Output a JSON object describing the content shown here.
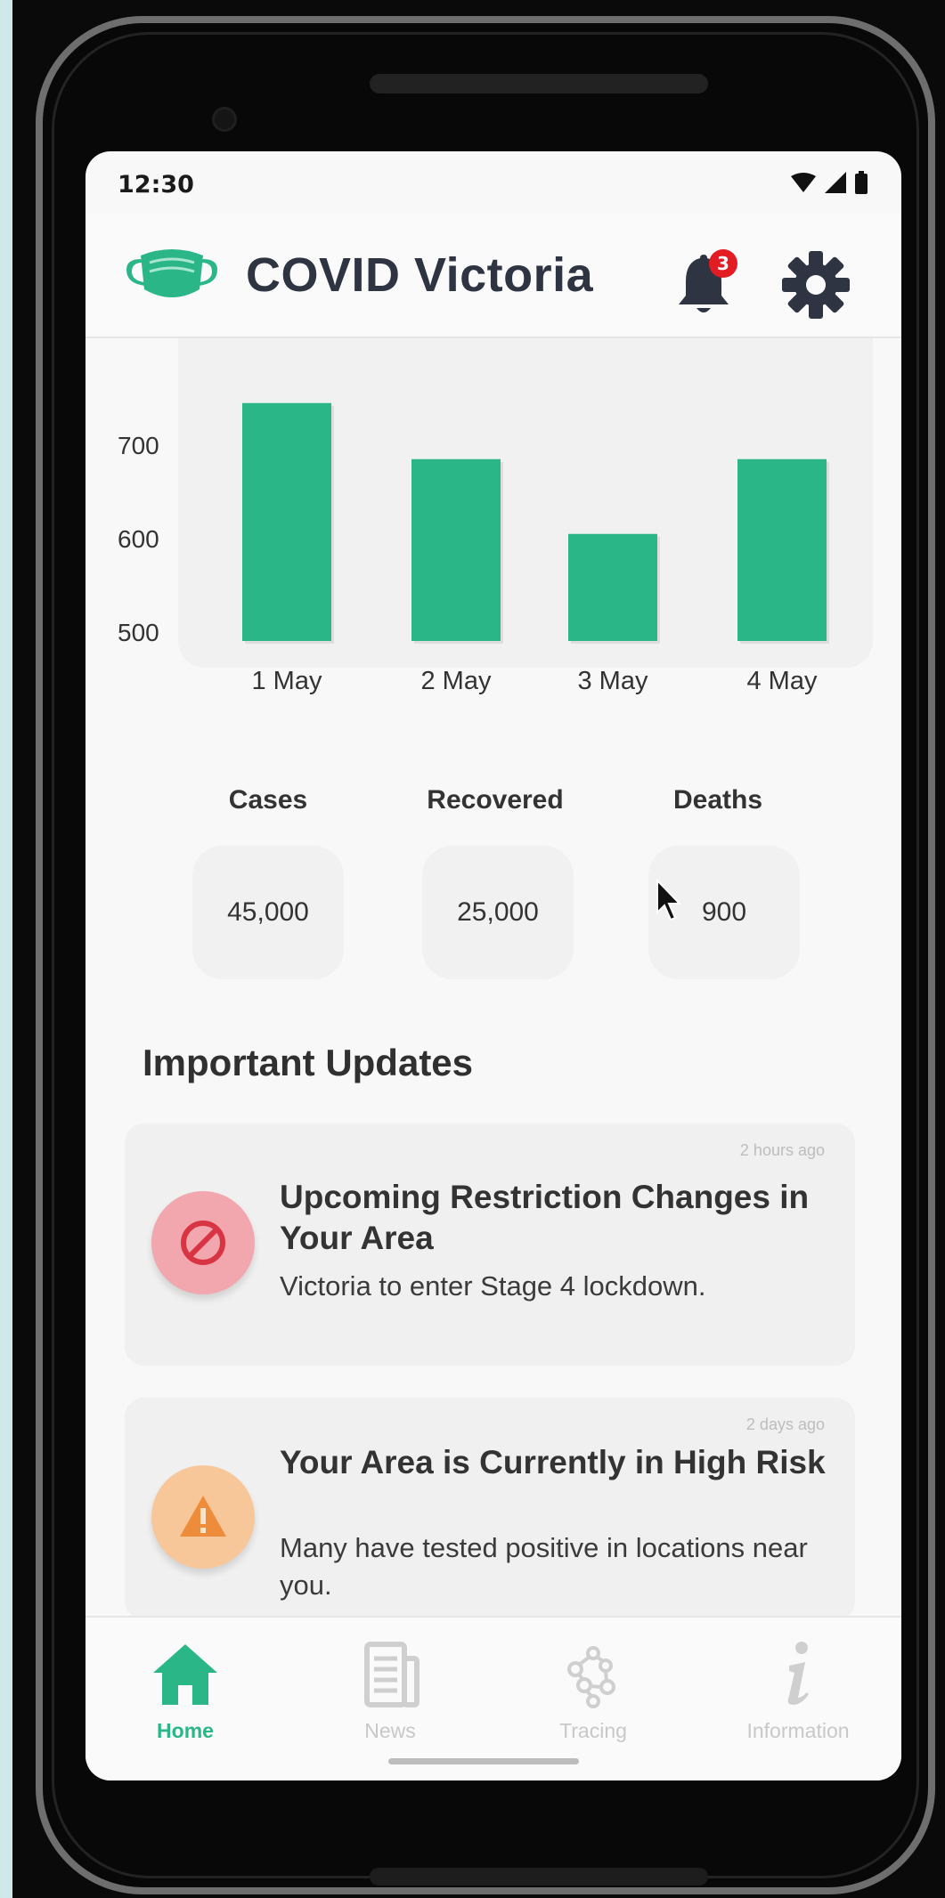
{
  "status_bar": {
    "time": "12:30"
  },
  "header": {
    "title": "COVID Victoria",
    "notification_count": "3",
    "accent_color": "#2bb688"
  },
  "chart_data": {
    "type": "bar",
    "categories": [
      "1 May",
      "2 May",
      "3 May",
      "4 May"
    ],
    "values": [
      745,
      685,
      605,
      685
    ],
    "yticks": [
      "700",
      "600",
      "500"
    ],
    "ylim": [
      500,
      750
    ],
    "grid": false,
    "bar_color": "#2bb688"
  },
  "stats": {
    "cases_label": "Cases",
    "cases_value": "45,000",
    "recovered_label": "Recovered",
    "recovered_value": "25,000",
    "deaths_label": "Deaths",
    "deaths_value": "900"
  },
  "updates": {
    "section_title": "Important Updates",
    "items": [
      {
        "time": "2 hours ago",
        "title": "Upcoming Restriction Changes in Your Area",
        "body": "Victoria to enter Stage 4 lockdown.",
        "icon": "no-entry-icon",
        "color": "#f1a7ad"
      },
      {
        "time": "2 days ago",
        "title": "Your Area is Currently in High Risk",
        "body": "Many have tested positive in locations near you.",
        "icon": "warning-icon",
        "color": "#f7c79a"
      }
    ]
  },
  "bottom_nav": {
    "items": [
      {
        "label": "Home",
        "icon": "home-icon",
        "active": true
      },
      {
        "label": "News",
        "icon": "news-icon",
        "active": false
      },
      {
        "label": "Tracing",
        "icon": "tracing-icon",
        "active": false
      },
      {
        "label": "Information",
        "icon": "information-icon",
        "active": false
      }
    ]
  }
}
